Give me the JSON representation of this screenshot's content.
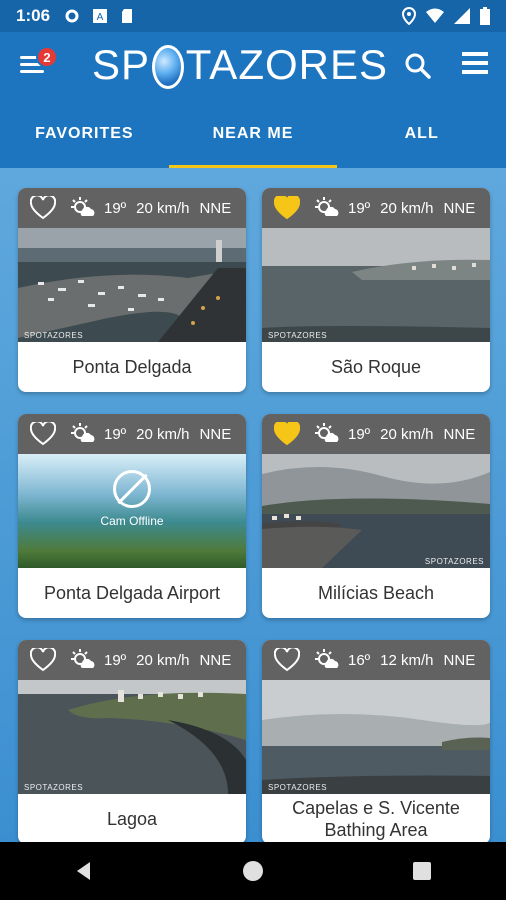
{
  "status_bar": {
    "time": "1:06"
  },
  "app": {
    "notification_count": "2",
    "logo_text_left": "SP",
    "logo_text_right": "TAZORES"
  },
  "tabs": [
    {
      "label": "FAVORITES"
    },
    {
      "label": "NEAR ME"
    },
    {
      "label": "ALL"
    }
  ],
  "colors": {
    "accent": "#f5c518",
    "app_bar": "#1d75c0",
    "badge": "#e53935"
  },
  "cards": [
    {
      "name": "Ponta Delgada",
      "favorite": false,
      "temp": "19º",
      "wind": "20 km/h",
      "dir": "NNE",
      "watermark": "SPOTAZORES"
    },
    {
      "name": "São Roque",
      "favorite": true,
      "temp": "19º",
      "wind": "20 km/h",
      "dir": "NNE",
      "watermark": "SPOTAZORES"
    },
    {
      "name": "Ponta Delgada Airport",
      "favorite": false,
      "temp": "19º",
      "wind": "20 km/h",
      "dir": "NNE",
      "offline": "Cam Offline"
    },
    {
      "name": "Milícias Beach",
      "favorite": true,
      "temp": "19º",
      "wind": "20 km/h",
      "dir": "NNE",
      "watermark": "SPOTAZORES"
    },
    {
      "name": "Lagoa",
      "favorite": false,
      "temp": "19º",
      "wind": "20 km/h",
      "dir": "NNE",
      "watermark": "SPOTAZORES"
    },
    {
      "name": "Capelas e S. Vicente Bathing Area",
      "favorite": false,
      "temp": "16º",
      "wind": "12 km/h",
      "dir": "NNE",
      "watermark": "SPOTAZORES"
    }
  ]
}
